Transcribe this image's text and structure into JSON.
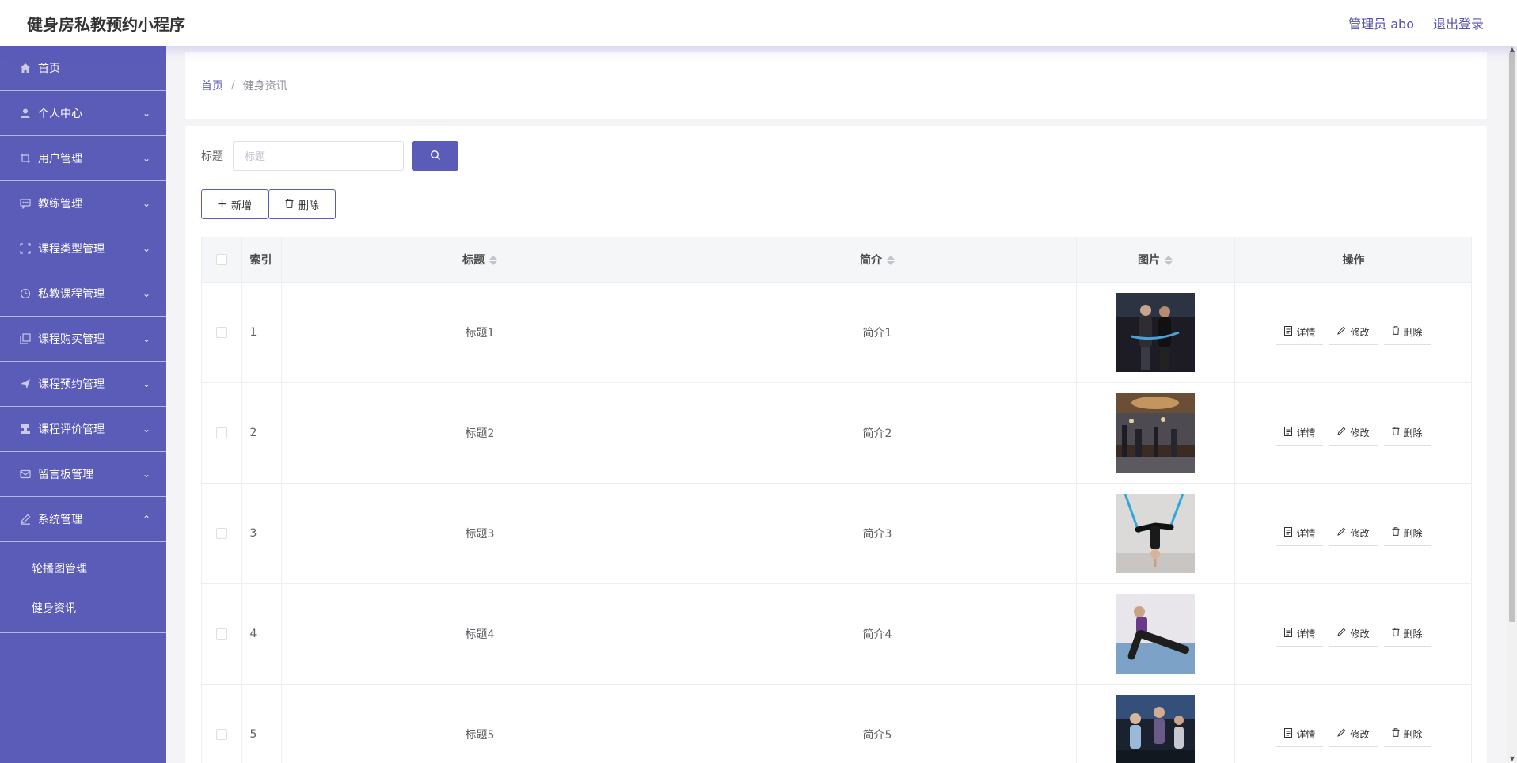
{
  "header": {
    "title": "健身房私教预约小程序",
    "user": "管理员 abo",
    "logout": "退出登录"
  },
  "sidebar": {
    "items": [
      {
        "label": "首页",
        "icon": "home-icon"
      },
      {
        "label": "个人中心",
        "icon": "user-icon"
      },
      {
        "label": "用户管理",
        "icon": "crop-icon"
      },
      {
        "label": "教练管理",
        "icon": "chat-icon"
      },
      {
        "label": "课程类型管理",
        "icon": "full-screen-icon"
      },
      {
        "label": "私教课程管理",
        "icon": "clock-icon"
      },
      {
        "label": "课程购买管理",
        "icon": "copy-icon"
      },
      {
        "label": "课程预约管理",
        "icon": "send-icon"
      },
      {
        "label": "课程评价管理",
        "icon": "stamp-icon"
      },
      {
        "label": "留言板管理",
        "icon": "message-icon"
      },
      {
        "label": "系统管理",
        "icon": "edit-outline-icon"
      }
    ],
    "subitems": [
      {
        "label": "轮播图管理"
      },
      {
        "label": "健身资讯"
      }
    ]
  },
  "breadcrumb": {
    "home": "首页",
    "separator": "/",
    "current": "健身资讯"
  },
  "search": {
    "label": "标题",
    "placeholder": "标题"
  },
  "actions": {
    "add": "新增",
    "delete": "删除"
  },
  "table": {
    "headers": {
      "index": "索引",
      "title": "标题",
      "intro": "简介",
      "image": "图片",
      "ops": "操作"
    },
    "op_labels": {
      "detail": "详情",
      "edit": "修改",
      "delete": "删除"
    },
    "rows": [
      {
        "index": "1",
        "title": "标题1",
        "intro": "简介1"
      },
      {
        "index": "2",
        "title": "标题2",
        "intro": "简介2"
      },
      {
        "index": "3",
        "title": "标题3",
        "intro": "简介3"
      },
      {
        "index": "4",
        "title": "标题4",
        "intro": "简介4"
      },
      {
        "index": "5",
        "title": "标题5",
        "intro": "简介5"
      }
    ]
  },
  "colors": {
    "primary": "#5b5bb8",
    "sidebar_bg": "#5b5bb8",
    "page_bg": "#f4f4f7"
  }
}
